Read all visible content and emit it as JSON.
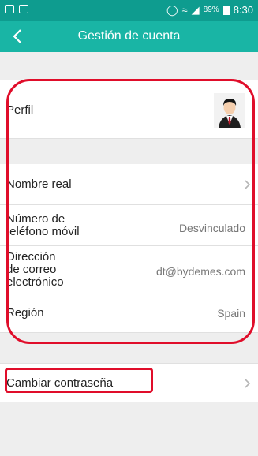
{
  "status_bar": {
    "battery": "89%",
    "time": "8:30"
  },
  "header": {
    "title": "Gestión de cuenta"
  },
  "profile": {
    "label": "Perfil"
  },
  "fields": {
    "real_name": {
      "label": "Nombre real",
      "value": ""
    },
    "phone": {
      "label_line1": "Número de",
      "label_line2": "teléfono móvil",
      "value": "Desvinculado"
    },
    "email": {
      "label_line1": "Dirección",
      "label_line2": "de correo",
      "label_line3": "electrónico",
      "value": "dt@bydemes.com"
    },
    "region": {
      "label": "Región",
      "value": "Spain"
    }
  },
  "password": {
    "label": "Cambiar contraseña"
  },
  "colors": {
    "status_bar": "#0e9c8f",
    "nav_bar": "#19b5a5",
    "highlight": "#e00d2a"
  },
  "icons": {
    "back": "chevron-left-icon",
    "row_arrow": "chevron-right-icon",
    "avatar": "user-avatar"
  }
}
